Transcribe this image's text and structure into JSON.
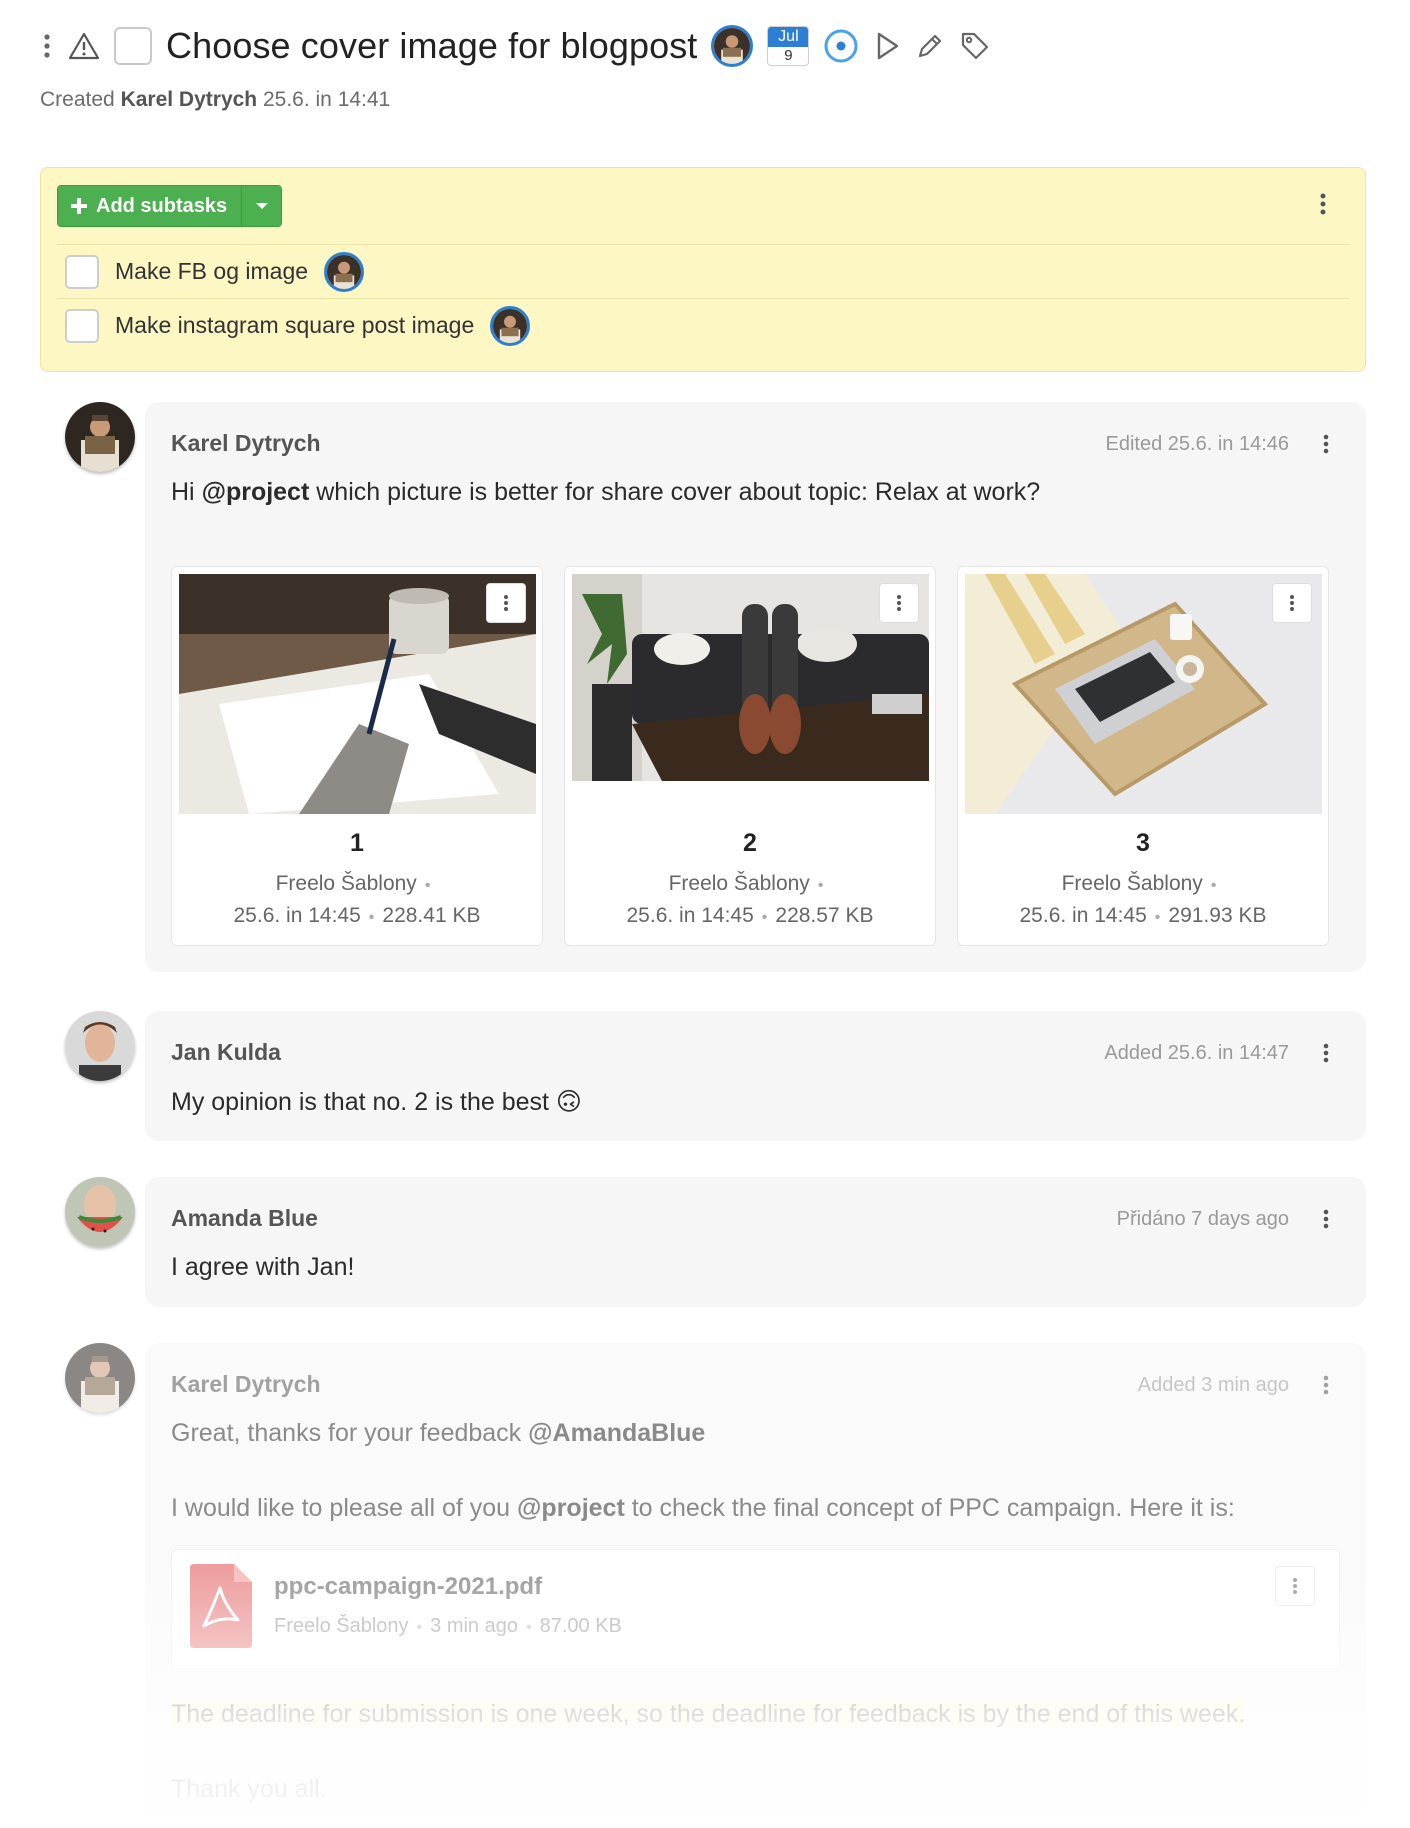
{
  "task": {
    "title": "Choose cover image for blogpost",
    "created_prefix": "Created",
    "created_by": "Karel Dytrych",
    "created_at": "25.6. in 14:41",
    "due": {
      "month": "Jul",
      "day": "9"
    }
  },
  "subtasks": {
    "add_label": "Add subtasks",
    "items": [
      {
        "label": "Make FB og image"
      },
      {
        "label": "Make instagram square post image"
      }
    ]
  },
  "comments": [
    {
      "author": "Karel Dytrych",
      "meta": "Edited 25.6. in 14:46",
      "text_pre": "Hi ",
      "mention": "@project",
      "text_post": " which picture is better for share cover about topic: Relax at work?",
      "attachments": [
        {
          "number": "1",
          "source": "Freelo Šablony",
          "date": "25.6. in 14:45",
          "size": "228.41 KB"
        },
        {
          "number": "2",
          "source": "Freelo Šablony",
          "date": "25.6. in 14:45",
          "size": "228.57 KB"
        },
        {
          "number": "3",
          "source": "Freelo Šablony",
          "date": "25.6. in 14:45",
          "size": "291.93 KB"
        }
      ]
    },
    {
      "author": "Jan Kulda",
      "meta": "Added 25.6. in 14:47",
      "text": "My opinion is that no. 2 is the best 🙃"
    },
    {
      "author": "Amanda Blue",
      "meta": "Přidáno 7 days ago",
      "text": "I agree with Jan!"
    },
    {
      "author": "Karel Dytrych",
      "meta": "Added 3 min ago",
      "line1_pre": "Great, thanks for your feedback ",
      "line1_mention": "@AmandaBlue",
      "line2_pre": "I would like to please all of you ",
      "line2_mention": "@project",
      "line2_post": " to check the final concept of PPC campaign. Here it is:",
      "file": {
        "name": "ppc-campaign-2021.pdf",
        "source": "Freelo Šablony",
        "time": "3 min ago",
        "size": "87.00 KB"
      },
      "line3": "The deadline for submission is one week, so the deadline for feedback is by the end of this week.",
      "line4": "Thank you all."
    }
  ],
  "colors": {
    "accent_green": "#4caf50",
    "subtask_bg": "#fdf7c4",
    "date_blue": "#2d7fd3",
    "pdf_red": "#e04b4b"
  }
}
